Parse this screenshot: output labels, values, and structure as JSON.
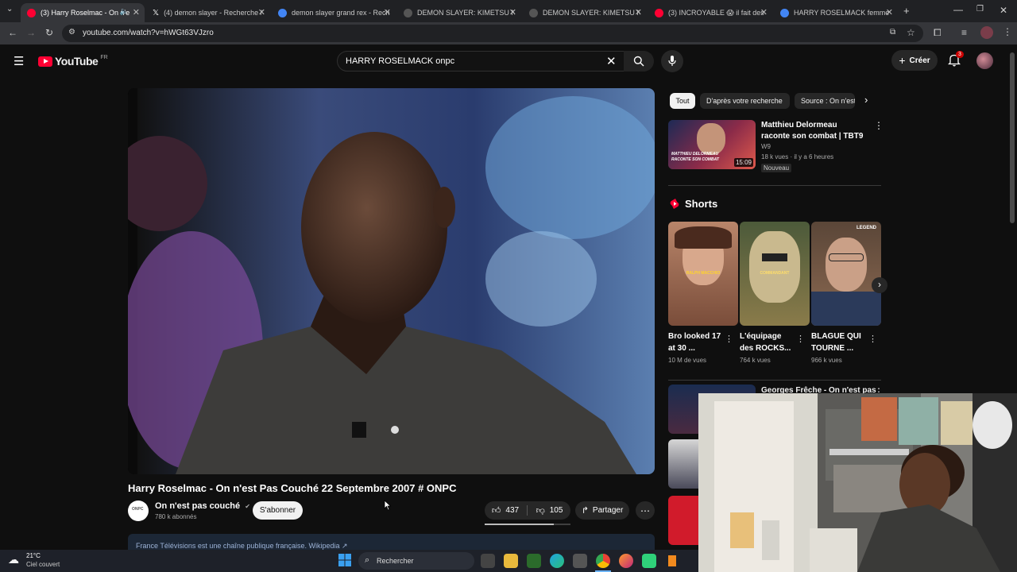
{
  "browser": {
    "tabs": [
      {
        "title": "(3) Harry Roselmac - On n'e",
        "color": "#ff0033"
      },
      {
        "title": "(4) demon slayer - Recherche /",
        "color": "#ffffff"
      },
      {
        "title": "demon slayer grand rex - Reche",
        "color": "#4285f4"
      },
      {
        "title": "DEMON SLAYER: KIMETSU NO",
        "color": "#444444"
      },
      {
        "title": "DEMON SLAYER: KIMETSU NO",
        "color": "#444444"
      },
      {
        "title": "(3) INCROYABLE 😱 il fait des n",
        "color": "#ff0033"
      },
      {
        "title": "HARRY ROSELMACK femme - R",
        "color": "#4285f4"
      }
    ],
    "url": "youtube.com/watch?v=hWGt63VJzro"
  },
  "youtube": {
    "logo_text": "YouTube",
    "region": "FR",
    "search_value": "HARRY ROSELMACK onpc",
    "create_label": "Créer",
    "notif_count": "3",
    "video": {
      "title": "Harry Roselmac - On n'est Pas Couché 22 Septembre 2007 # ONPC",
      "channel": "On n'est pas couché",
      "subscribers": "780 k abonnés",
      "subscribe_label": "S'abonner",
      "likes": "437",
      "dislikes": "105",
      "share_label": "Partager",
      "description_snippet": "France Télévisions est une chaîne publique française.  Wikipedia ↗"
    },
    "chips": [
      "Tout",
      "D'après votre recherche",
      "Source : On n'est"
    ],
    "recommendation": {
      "title": "Matthieu Delormeau raconte son combat | TBT9",
      "channel": "W9",
      "meta": "18 k vues · il y a 6 heures",
      "badge": "Nouveau",
      "duration": "15:09",
      "thumb_caption": "MATTHIEU DELORMEAU RACONTE SON COMBAT"
    },
    "shorts_heading": "Shorts",
    "shorts": [
      {
        "title": "Bro looked 17 at 30 ...",
        "views": "10 M de vues",
        "overlay": "RALPH MACCHIO"
      },
      {
        "title": "L'équipage des ROCKS...",
        "views": "764 k vues",
        "overlay": "COMMANDANT"
      },
      {
        "title": "BLAGUE QUI TOURNE ...",
        "views": "966 k vues",
        "overlay": "LEGEND"
      }
    ],
    "next_rec_title": "Georges Frêche - On n'est pas"
  },
  "taskbar": {
    "temperature": "21°C",
    "weather": "Ciel couvert",
    "search_placeholder": "Rechercher"
  }
}
